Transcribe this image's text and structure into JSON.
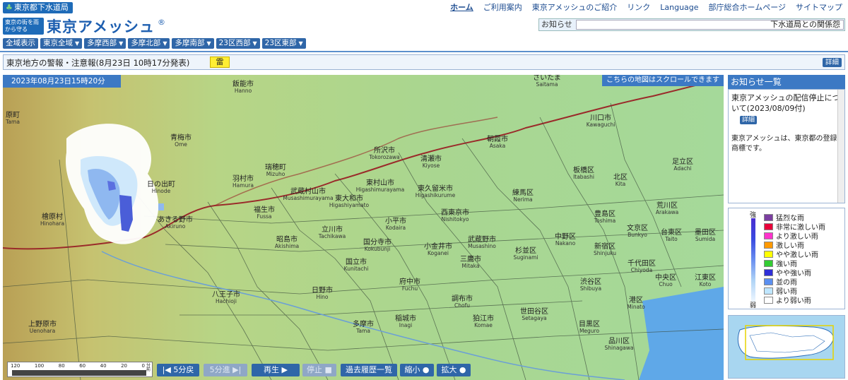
{
  "header": {
    "org_label": "東京都下水道局",
    "menu": [
      {
        "label": "ホーム",
        "active": true
      },
      {
        "label": "ご利用案内"
      },
      {
        "label": "東京アメッシュのご紹介"
      },
      {
        "label": "リンク"
      },
      {
        "label": "Language"
      },
      {
        "label": "部庁総合ホームページ"
      },
      {
        "label": "サイトマップ"
      }
    ],
    "logo_sub": "東京の街を雨から守る",
    "logo_main": "東京アメッシュ",
    "logo_mark": "®"
  },
  "notice_bar": {
    "label": "お知らせ",
    "text": "下水道局との関係怨"
  },
  "area_buttons": [
    {
      "label": "全域表示",
      "dropdown": false
    },
    {
      "label": "東京全域",
      "dropdown": true
    },
    {
      "label": "多摩西部",
      "dropdown": true
    },
    {
      "label": "多摩北部",
      "dropdown": true
    },
    {
      "label": "多摩南部",
      "dropdown": true
    },
    {
      "label": "23区西部",
      "dropdown": true
    },
    {
      "label": "23区東部",
      "dropdown": true
    }
  ],
  "warning": {
    "text": "東京地方の警報・注意報(8月23日 10時17分発表)",
    "badge": "雷",
    "badge_color": "#ffee33",
    "detail": "詳細"
  },
  "map": {
    "timestamp": "2023年08月23日15時20分",
    "scroll_note": "こちらの地図はスクロールできます",
    "places": [
      {
        "ja": "飯能市",
        "en": "Hanno"
      },
      {
        "ja": "さいたま",
        "en": "Saitama"
      },
      {
        "ja": "川口市",
        "en": "Kawaguchi"
      },
      {
        "ja": "原町",
        "en": "Tama"
      },
      {
        "ja": "青梅市",
        "en": "Ome"
      },
      {
        "ja": "朝霞市",
        "en": "Asaka"
      },
      {
        "ja": "所沢市",
        "en": "Tokorozawa"
      },
      {
        "ja": "清瀬市",
        "en": "Kiyose"
      },
      {
        "ja": "足立区",
        "en": "Adachi"
      },
      {
        "ja": "羽村市",
        "en": "Hamura"
      },
      {
        "ja": "瑞穂町",
        "en": "Mizuho"
      },
      {
        "ja": "東村山市",
        "en": "Higashimurayama"
      },
      {
        "ja": "東久留米市",
        "en": "Higashikurume"
      },
      {
        "ja": "板橋区",
        "en": "Itabashi"
      },
      {
        "ja": "北区",
        "en": "Kita"
      },
      {
        "ja": "日の出町",
        "en": "Hinode"
      },
      {
        "ja": "武蔵村山市",
        "en": "Musashimurayama"
      },
      {
        "ja": "東大和市",
        "en": "Higashiyamato"
      },
      {
        "ja": "練馬区",
        "en": "Nerima"
      },
      {
        "ja": "荒川区",
        "en": "Arakawa"
      },
      {
        "ja": "檜原村",
        "en": "Hinohara"
      },
      {
        "ja": "福生市",
        "en": "Fussa"
      },
      {
        "ja": "西東京市",
        "en": "Nishitokyo"
      },
      {
        "ja": "豊島区",
        "en": "Toshima"
      },
      {
        "ja": "あきる野市",
        "en": "Akiruno"
      },
      {
        "ja": "小平市",
        "en": "Kodaira"
      },
      {
        "ja": "文京区",
        "en": "Bunkyo"
      },
      {
        "ja": "台東区",
        "en": "Taito"
      },
      {
        "ja": "墨田区",
        "en": "Sumida"
      },
      {
        "ja": "昭島市",
        "en": "Akishima"
      },
      {
        "ja": "立川市",
        "en": "Tachikawa"
      },
      {
        "ja": "国分寺市",
        "en": "Kokubunji"
      },
      {
        "ja": "武蔵野市",
        "en": "Musashino"
      },
      {
        "ja": "中野区",
        "en": "Nakano"
      },
      {
        "ja": "新宿区",
        "en": "Shinjuku"
      },
      {
        "ja": "小金井市",
        "en": "Koganei"
      },
      {
        "ja": "杉並区",
        "en": "Suginami"
      },
      {
        "ja": "千代田区",
        "en": "Chiyoda"
      },
      {
        "ja": "国立市",
        "en": "Kunitachi"
      },
      {
        "ja": "三鷹市",
        "en": "Mitaka"
      },
      {
        "ja": "中央区",
        "en": "Chuo"
      },
      {
        "ja": "江東区",
        "en": "Koto"
      },
      {
        "ja": "渋谷区",
        "en": "Shibuya"
      },
      {
        "ja": "八王子市",
        "en": "Hachioji"
      },
      {
        "ja": "日野市",
        "en": "Hino"
      },
      {
        "ja": "府中市",
        "en": "Fuchu"
      },
      {
        "ja": "調布市",
        "en": "Chofu"
      },
      {
        "ja": "港区",
        "en": "Minato"
      },
      {
        "ja": "上野原市",
        "en": "Uenohara"
      },
      {
        "ja": "多摩市",
        "en": "Tama"
      },
      {
        "ja": "稲城市",
        "en": "Inagi"
      },
      {
        "ja": "狛江市",
        "en": "Komae"
      },
      {
        "ja": "世田谷区",
        "en": "Setagaya"
      },
      {
        "ja": "目黒区",
        "en": "Meguro"
      },
      {
        "ja": "品川区",
        "en": "Shinagawa"
      }
    ]
  },
  "scale_bar": {
    "ticks": [
      "120",
      "100",
      "80",
      "60",
      "40",
      "20",
      "0"
    ],
    "unit": "分前"
  },
  "controls": [
    {
      "label": "|◀ 5分戻",
      "enabled": true
    },
    {
      "label": "5分進 ▶|",
      "enabled": false
    },
    {
      "label": "再生 ▶",
      "enabled": true
    },
    {
      "label": "停止 ■",
      "enabled": false
    },
    {
      "label": "過去履歴一覧",
      "enabled": true
    },
    {
      "label": "縮小 ●",
      "enabled": true
    },
    {
      "label": "拡大 ●",
      "enabled": true
    }
  ],
  "news_panel": {
    "title": "お知らせ一覧",
    "item": "東京アメッシュの配信停止について(2023/08/09付)",
    "detail": "詳細",
    "note": "東京アメッシュは、東京都の登録商標です。"
  },
  "legend": {
    "strong_label": "強",
    "weak_label": "弱",
    "items": [
      {
        "label": "猛烈な雨",
        "color": "#7b3fa0"
      },
      {
        "label": "非常に激しい雨",
        "color": "#e8003a"
      },
      {
        "label": "より激しい雨",
        "color": "#ff33cc"
      },
      {
        "label": "激しい雨",
        "color": "#ff9900"
      },
      {
        "label": "やや激しい雨",
        "color": "#ffff00"
      },
      {
        "label": "強い雨",
        "color": "#33cc33"
      },
      {
        "label": "やや強い雨",
        "color": "#2f2fd8"
      },
      {
        "label": "並の雨",
        "color": "#5b8ff0"
      },
      {
        "label": "弱い雨",
        "color": "#bfe6ff"
      },
      {
        "label": "より弱い雨",
        "color": "#ffffff"
      }
    ]
  }
}
